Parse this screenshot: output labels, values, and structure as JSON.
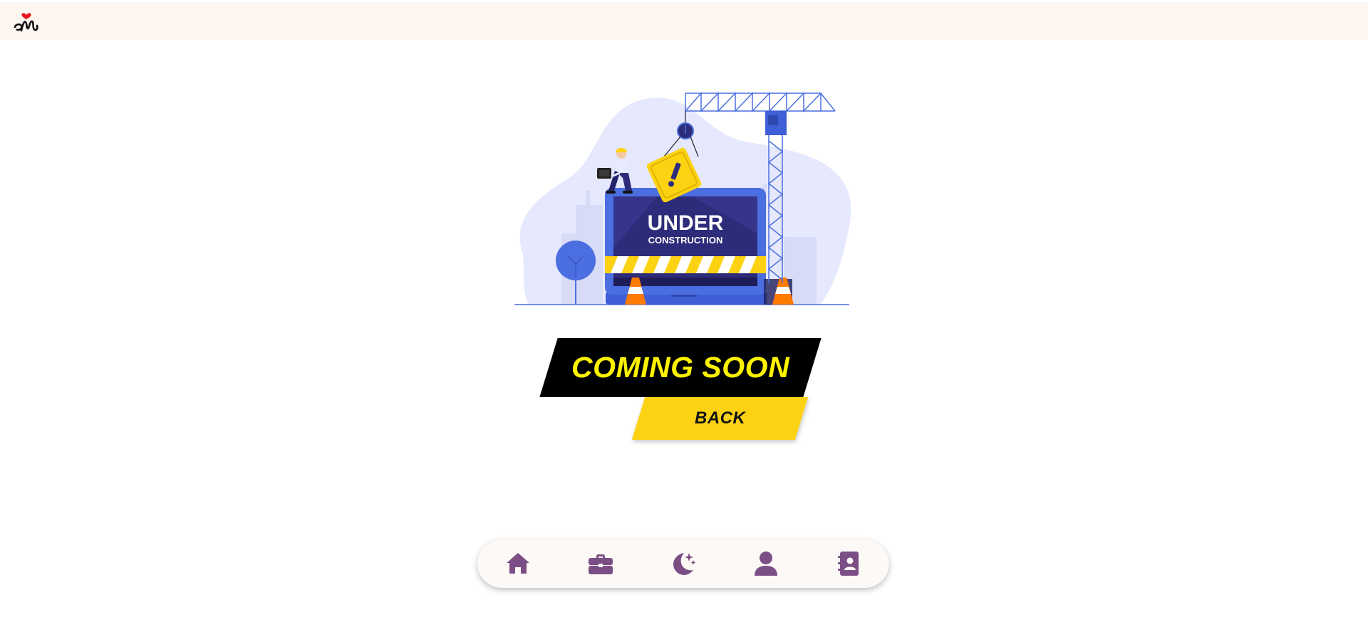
{
  "header": {
    "logo_icon": "om-heart-logo-icon"
  },
  "illustration": {
    "icon": "under-construction-illustration",
    "sign_title": "UNDER",
    "sign_subtitle": "CONSTRUCTION"
  },
  "banner": {
    "title": "COMING SOON"
  },
  "actions": {
    "back_label": "BACK"
  },
  "bottom_nav": {
    "items": [
      {
        "name": "home",
        "icon": "home-icon"
      },
      {
        "name": "work",
        "icon": "briefcase-icon"
      },
      {
        "name": "night",
        "icon": "moon-stars-icon"
      },
      {
        "name": "profile",
        "icon": "user-icon"
      },
      {
        "name": "contacts",
        "icon": "contact-book-icon"
      }
    ]
  },
  "colors": {
    "header_bg": "#fdf6f0",
    "banner_bg": "#000000",
    "banner_text": "#fff200",
    "back_bg": "#fdd213",
    "nav_icon": "#7b4f86",
    "illustration_blue": "#4b6fe0",
    "illustration_blob": "#e6e8fd"
  }
}
